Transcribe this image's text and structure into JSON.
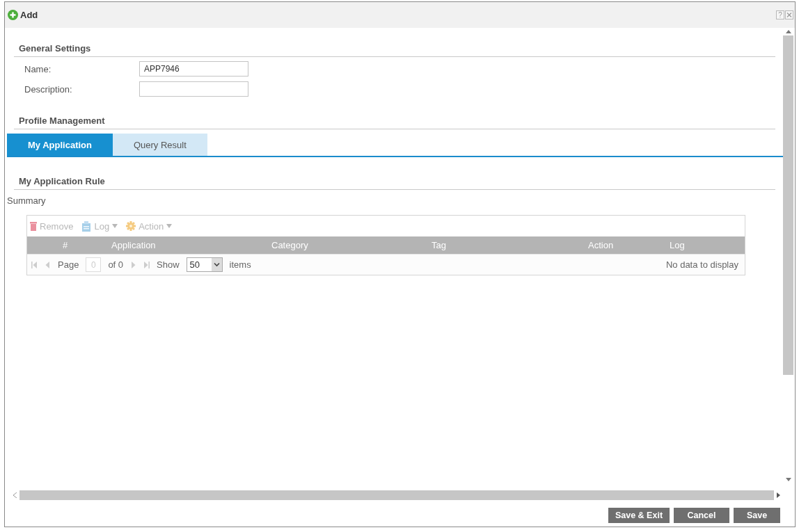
{
  "window": {
    "title": "Add",
    "help_button": "?"
  },
  "general_settings": {
    "heading": "General Settings",
    "fields": [
      {
        "label": "Name:",
        "value": "APP7946"
      },
      {
        "label": "Description:"
      }
    ]
  },
  "profile_management": {
    "heading": "Profile Management",
    "tabs": [
      {
        "label": "My Application",
        "selected": true
      },
      {
        "label": "Query Result",
        "selected": false
      }
    ]
  },
  "rule_section": {
    "heading": "My Application Rule",
    "subheading": "Summary"
  },
  "table": {
    "toolbar": [
      {
        "kind": "remove",
        "label": "Remove",
        "disabled": true,
        "dropdown": false
      },
      {
        "kind": "log",
        "label": "Log",
        "disabled": true,
        "dropdown": true
      },
      {
        "kind": "action",
        "label": "Action",
        "disabled": true,
        "dropdown": true
      }
    ],
    "columns": [
      "#",
      "Application",
      "Category",
      "Tag",
      "Action",
      "Log"
    ],
    "pager": {
      "disabled": true,
      "page_label": "Page",
      "page": "0",
      "of": "of 0",
      "show_label": "Show",
      "page_size": "50",
      "items_label": "items",
      "status": "No data to display"
    }
  },
  "buttons": [
    "Save & Exit",
    "Cancel",
    "Save"
  ]
}
